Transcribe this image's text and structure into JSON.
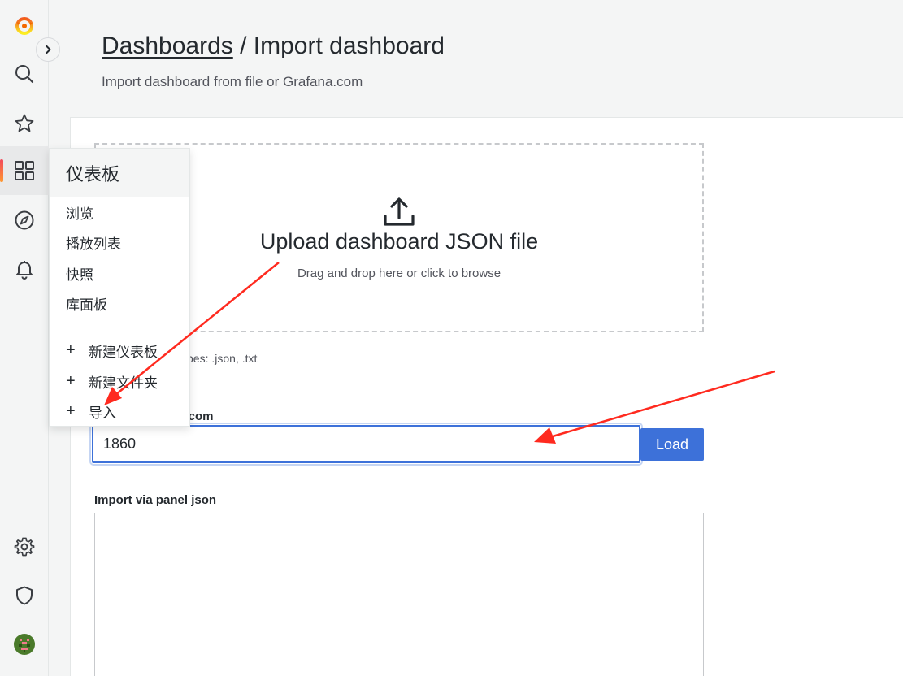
{
  "header": {
    "breadcrumb_link": "Dashboards",
    "separator": " / ",
    "title": "Import dashboard",
    "subtitle": "Import dashboard from file or Grafana.com"
  },
  "sidebar": {
    "items": [
      {
        "name": "grafana-logo",
        "icon": "grafana-logo"
      },
      {
        "name": "search",
        "icon": "search-icon"
      },
      {
        "name": "starred",
        "icon": "star-icon"
      },
      {
        "name": "dashboards",
        "icon": "apps-icon",
        "active": true
      },
      {
        "name": "explore",
        "icon": "compass-icon"
      },
      {
        "name": "alerting",
        "icon": "bell-icon"
      },
      {
        "name": "configuration",
        "icon": "gear-icon"
      },
      {
        "name": "server-admin",
        "icon": "shield-icon"
      },
      {
        "name": "profile",
        "icon": "avatar"
      }
    ],
    "expand_icon": "chevron-right-icon"
  },
  "menu": {
    "title": "仪表板",
    "items": [
      "浏览",
      "播放列表",
      "快照",
      "库面板"
    ],
    "actions": [
      "新建仪表板",
      "新建文件夹",
      "导入"
    ]
  },
  "upload": {
    "title": "Upload dashboard JSON file",
    "subtitle": "Drag and drop here or click to browse",
    "accepted_visible": "pes: .json, .txt"
  },
  "grafana_import": {
    "label_visible": "na.com",
    "value": "1860",
    "load_label": "Load"
  },
  "panel_json": {
    "label": "Import via panel json",
    "value": ""
  },
  "colors": {
    "accent": "#3d71d9",
    "arrow": "#ff2a1f",
    "brand": "#f46800"
  }
}
